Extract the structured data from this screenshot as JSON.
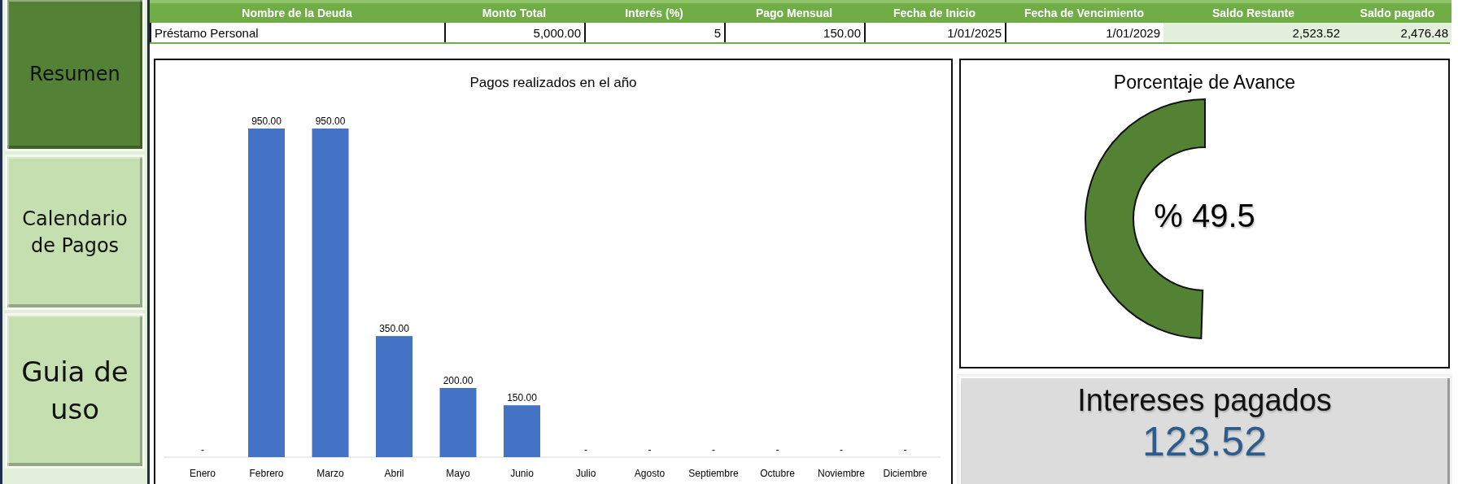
{
  "sidebar": {
    "items": [
      {
        "label": "Resumen",
        "selected": true
      },
      {
        "label": "Calendario de Pagos",
        "selected": false
      },
      {
        "label": "Guia de uso",
        "selected": false
      }
    ]
  },
  "debt_table": {
    "columns": [
      {
        "label": "Nombre de la Deuda",
        "highlight": false
      },
      {
        "label": "Monto Total",
        "highlight": false
      },
      {
        "label": "Interés (%)",
        "highlight": false
      },
      {
        "label": "Pago Mensual",
        "highlight": false
      },
      {
        "label": "Fecha de Inicio",
        "highlight": false
      },
      {
        "label": "Fecha de Vencimiento",
        "highlight": false
      },
      {
        "label": "Saldo Restante",
        "highlight": true
      },
      {
        "label": "Saldo pagado",
        "highlight": true
      }
    ],
    "rows": [
      {
        "cells": [
          "Préstamo Personal",
          "5,000.00",
          "5",
          "150.00",
          "1/01/2025",
          "1/01/2029",
          "2,523.52",
          "2,476.48"
        ]
      }
    ]
  },
  "payments_chart": {
    "chart_data": {
      "type": "bar",
      "title": "Pagos realizados en el año",
      "categories": [
        "Enero",
        "Febrero",
        "Marzo",
        "Abril",
        "Mayo",
        "Junio",
        "Julio",
        "Agosto",
        "Septiembre",
        "Octubre",
        "Noviembre",
        "Diciembre"
      ],
      "series": [
        {
          "color": "#4472c4",
          "values": [
            0,
            950,
            950,
            350,
            200,
            150,
            0,
            0,
            0,
            0,
            0,
            0
          ],
          "value_labels": [
            "-",
            "950.00",
            "950.00",
            "350.00",
            "200.00",
            "150.00",
            "-",
            "-",
            "-",
            "-",
            "-",
            "-"
          ]
        }
      ],
      "data_labels": true
    }
  },
  "progress": {
    "title": "Porcentaje de Avance",
    "level": 0.495,
    "reading": "% 49.5"
  },
  "interest": {
    "label": "Intereses pagados",
    "value": "123.52"
  }
}
